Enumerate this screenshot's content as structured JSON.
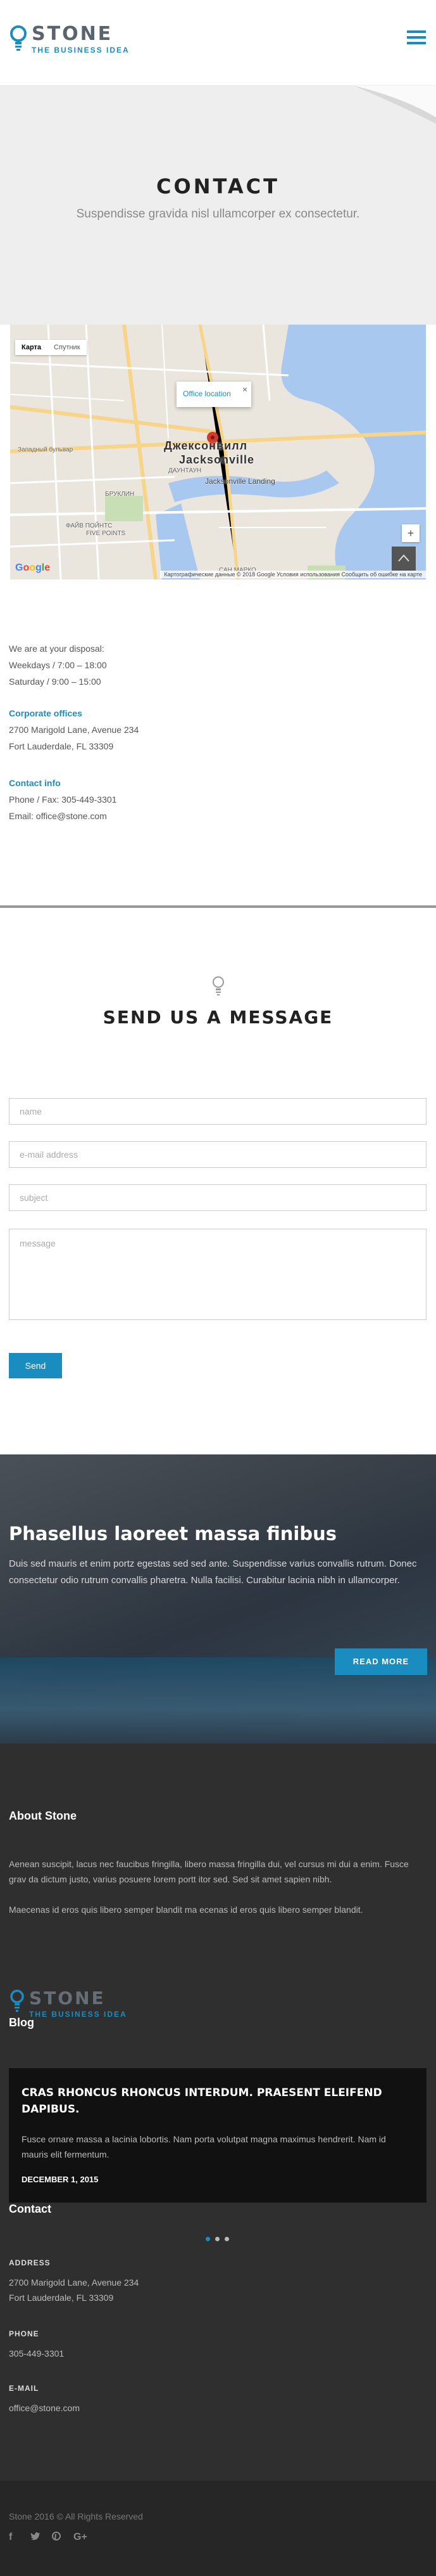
{
  "header": {
    "logo_name": "STONE",
    "logo_tagline": "THE BUSINESS IDEA",
    "accent_color": "#1a8dc0"
  },
  "page": {
    "title": "CONTACT",
    "subtitle": "Suspendisse gravida nisl ullamcorper ex consectetur."
  },
  "map": {
    "type_map": "Карта",
    "type_satellite": "Спутник",
    "popup_text": "Office location",
    "popup_close": "×",
    "city_ru": "Джексонвилл",
    "city_en": "Jacksonville",
    "landing": "Jacksonville Landing",
    "labels": [
      "ФАЙВ ПОЙНТС",
      "FIVE POINTS",
      "САН МАРКО",
      "БРУКЛИН",
      "Западный бульвар",
      "ДАУНТАУН"
    ],
    "zoom_in": "+",
    "zoom_out": "−",
    "google": "Google",
    "footer": "Картографические данные © 2018 Google   Условия использования   Сообщить об ошибке на карте"
  },
  "info": {
    "intro": "We are at your disposal:",
    "hours_weekdays": "Weekdays / 7:00 – 18:00",
    "hours_saturday": "Saturday / 9:00 – 15:00",
    "offices_heading": "Corporate offices",
    "address_line1": "2700 Marigold Lane, Avenue 234",
    "address_line2": "Fort Lauderdale, FL 33309",
    "contact_heading": "Contact info",
    "phone": "Phone / Fax: 305-449-3301",
    "email": "Email: office@stone.com"
  },
  "form": {
    "title": "SEND US A MESSAGE",
    "name_placeholder": "name",
    "email_placeholder": "e-mail address",
    "subject_placeholder": "subject",
    "message_placeholder": "message",
    "send_label": "Send"
  },
  "banner": {
    "title": "Phasellus laoreet massa finibus",
    "text": "Duis sed mauris et enim portz egestas sed sed ante. Suspendisse varius convallis rutrum. Donec consectetur odio rutrum convallis pharetra. Nulla facilisi. Curabitur lacinia nibh in ullamcorper.",
    "button": "READ MORE"
  },
  "footer": {
    "about_heading": "About Stone",
    "about_p1": "Aenean suscipit, lacus nec faucibus fringilla, libero massa fringilla dui, vel cursus mi dui a enim. Fusce grav da dictum justo, varius posuere lorem portt itor sed. Sed sit amet sapien nibh.",
    "about_p2": "Maecenas id eros quis libero semper blandit ma ecenas id eros quis libero semper blandit.",
    "logo_name": "STONE",
    "logo_tagline": "THE BUSINESS IDEA",
    "blog_heading": "Blog",
    "post_title": "CRAS RHONCUS RHONCUS INTERDUM. PRAESENT ELEIFEND DAPIBUS.",
    "post_text": "Fusce ornare massa a lacinia lobortis. Nam porta volutpat magna maximus hendrerit. Nam id mauris elit fermentum.",
    "post_date": "DECEMBER 1, 2015",
    "contact_heading": "Contact",
    "address_label": "ADDRESS",
    "address_line1": "2700 Marigold Lane, Avenue 234",
    "address_line2": "Fort Lauderdale, FL 33309",
    "phone_label": "PHONE",
    "phone": "305-449-3301",
    "email_label": "E-MAIL",
    "email": "office@stone.com",
    "copyright": "Stone 2016 © All Rights Reserved",
    "socials": [
      "facebook-icon",
      "twitter-icon",
      "pinterest-icon",
      "googleplus-icon"
    ]
  }
}
